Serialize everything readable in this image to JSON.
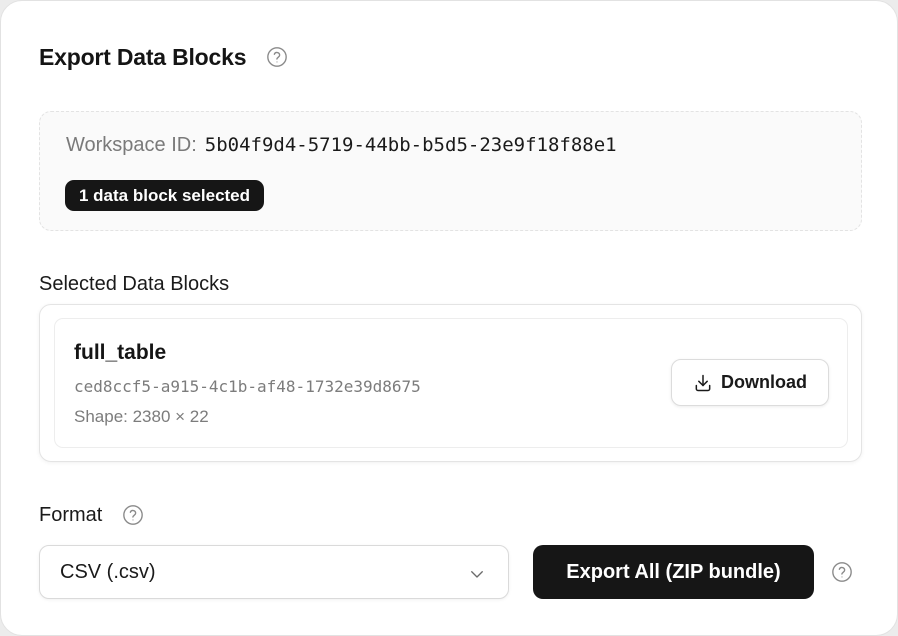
{
  "header": {
    "title": "Export Data Blocks",
    "help_icon": "question-circle-icon"
  },
  "workspace": {
    "label": "Workspace ID:",
    "id": "5b04f9d4-5719-44bb-b5d5-23e9f18f88e1",
    "selection_badge": "1 data block selected"
  },
  "selected_blocks": {
    "heading": "Selected Data Blocks",
    "items": [
      {
        "name": "full_table",
        "id": "ced8ccf5-a915-4c1b-af48-1732e39d8675",
        "shape": "Shape: 2380 × 22",
        "download_label": "Download",
        "download_icon": "download-icon"
      }
    ]
  },
  "format": {
    "label": "Format",
    "help_icon": "question-circle-icon",
    "selected": "CSV (.csv)",
    "chevron_icon": "chevron-down-icon"
  },
  "actions": {
    "export_all_label": "Export All (ZIP bundle)",
    "export_help_icon": "question-circle-icon"
  },
  "colors": {
    "dark_button": "#161616",
    "muted_text": "#7a7a7a",
    "panel_bg": "#ffffff"
  }
}
